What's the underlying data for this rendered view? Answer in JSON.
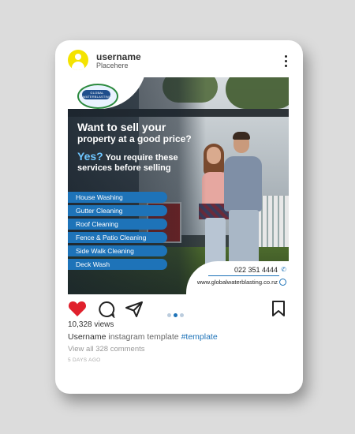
{
  "post": {
    "username": "username",
    "placeholder": "Placehere"
  },
  "ad": {
    "headline_1": "Want to sell your",
    "headline_2": "property at a good price?",
    "yes": "Yes?",
    "subline": "You require these services before selling",
    "services": [
      "House Washing",
      "Gutter Cleaning",
      "Roof Cleaning",
      "Fence & Patio Cleaning",
      "Side Walk Cleaning",
      "Deck Wash"
    ],
    "logo_text": "GLOBAL WATERBLASTING",
    "phone": "022 351 4444",
    "website": "www.globalwaterblasting.co.nz"
  },
  "stats": {
    "views": "10,328 views",
    "caption_user": "Username",
    "caption_text": "instagram template",
    "caption_tag": "#template",
    "view_all": "View all 328 comments",
    "time_ago": "5 DAYS AGO"
  },
  "icons": {
    "like": "heart-icon",
    "comment": "comment-icon",
    "share": "send-icon",
    "save": "bookmark-icon",
    "more": "more-icon"
  },
  "colors": {
    "accent": "#1e73b8",
    "like": "#e0202c",
    "avatar": "#f4e300"
  },
  "carousel": {
    "slides": 3,
    "active_index": 1
  }
}
